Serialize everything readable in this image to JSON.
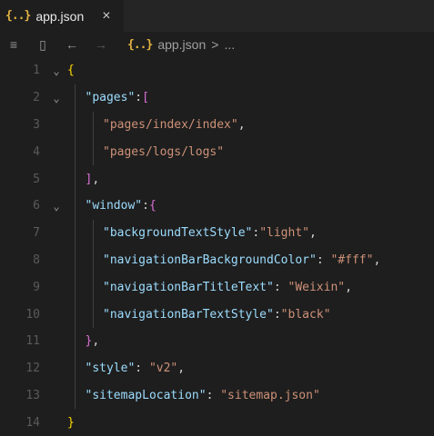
{
  "tab": {
    "icon": "{..}",
    "title": "app.json",
    "close": "×"
  },
  "toolbar": {
    "list_icon": "≡",
    "bookmark_icon": "▯",
    "back_icon": "←",
    "forward_icon": "→",
    "crumb_icon": "{..}",
    "crumb_file": "app.json",
    "crumb_sep": ">",
    "crumb_more": "..."
  },
  "editor": {
    "lines": [
      {
        "n": "1",
        "fold": "⌄",
        "tokens": [
          [
            "b1",
            "{"
          ]
        ]
      },
      {
        "n": "2",
        "fold": "⌄",
        "indent": 1,
        "tokens": [
          [
            "k",
            "\"pages\""
          ],
          [
            "p",
            ":"
          ],
          [
            "b2",
            "["
          ]
        ]
      },
      {
        "n": "3",
        "fold": "",
        "indent": 2,
        "tokens": [
          [
            "s",
            "\"pages/index/index\""
          ],
          [
            "p",
            ","
          ]
        ]
      },
      {
        "n": "4",
        "fold": "",
        "indent": 2,
        "tokens": [
          [
            "s",
            "\"pages/logs/logs\""
          ]
        ]
      },
      {
        "n": "5",
        "fold": "",
        "indent": 1,
        "tokens": [
          [
            "b2",
            "]"
          ],
          [
            "p",
            ","
          ]
        ]
      },
      {
        "n": "6",
        "fold": "⌄",
        "indent": 1,
        "tokens": [
          [
            "k",
            "\"window\""
          ],
          [
            "p",
            ":"
          ],
          [
            "b2",
            "{"
          ]
        ]
      },
      {
        "n": "7",
        "fold": "",
        "indent": 2,
        "tokens": [
          [
            "k",
            "\"backgroundTextStyle\""
          ],
          [
            "p",
            ":"
          ],
          [
            "s",
            "\"light\""
          ],
          [
            "p",
            ","
          ]
        ]
      },
      {
        "n": "8",
        "fold": "",
        "indent": 2,
        "tokens": [
          [
            "k",
            "\"navigationBarBackgroundColor\""
          ],
          [
            "p",
            ": "
          ],
          [
            "s",
            "\"#fff\""
          ],
          [
            "p",
            ","
          ]
        ]
      },
      {
        "n": "9",
        "fold": "",
        "indent": 2,
        "tokens": [
          [
            "k",
            "\"navigationBarTitleText\""
          ],
          [
            "p",
            ": "
          ],
          [
            "s",
            "\"Weixin\""
          ],
          [
            "p",
            ","
          ]
        ]
      },
      {
        "n": "10",
        "fold": "",
        "indent": 2,
        "tokens": [
          [
            "k",
            "\"navigationBarTextStyle\""
          ],
          [
            "p",
            ":"
          ],
          [
            "s",
            "\"black\""
          ]
        ]
      },
      {
        "n": "11",
        "fold": "",
        "indent": 1,
        "tokens": [
          [
            "b2",
            "}"
          ],
          [
            "p",
            ","
          ]
        ]
      },
      {
        "n": "12",
        "fold": "",
        "indent": 1,
        "tokens": [
          [
            "k",
            "\"style\""
          ],
          [
            "p",
            ": "
          ],
          [
            "s",
            "\"v2\""
          ],
          [
            "p",
            ","
          ]
        ]
      },
      {
        "n": "13",
        "fold": "",
        "indent": 1,
        "tokens": [
          [
            "k",
            "\"sitemapLocation\""
          ],
          [
            "p",
            ": "
          ],
          [
            "s",
            "\"sitemap.json\""
          ]
        ]
      },
      {
        "n": "14",
        "fold": "",
        "tokens": [
          [
            "b1",
            "}"
          ]
        ]
      }
    ]
  },
  "colors": {
    "background": "#1e1e1e",
    "key": "#9cdcfe",
    "string": "#ce9178",
    "outer_brace": "#ffd700",
    "inner_bracket": "#da70d6",
    "line_number": "#5a5a5a"
  }
}
